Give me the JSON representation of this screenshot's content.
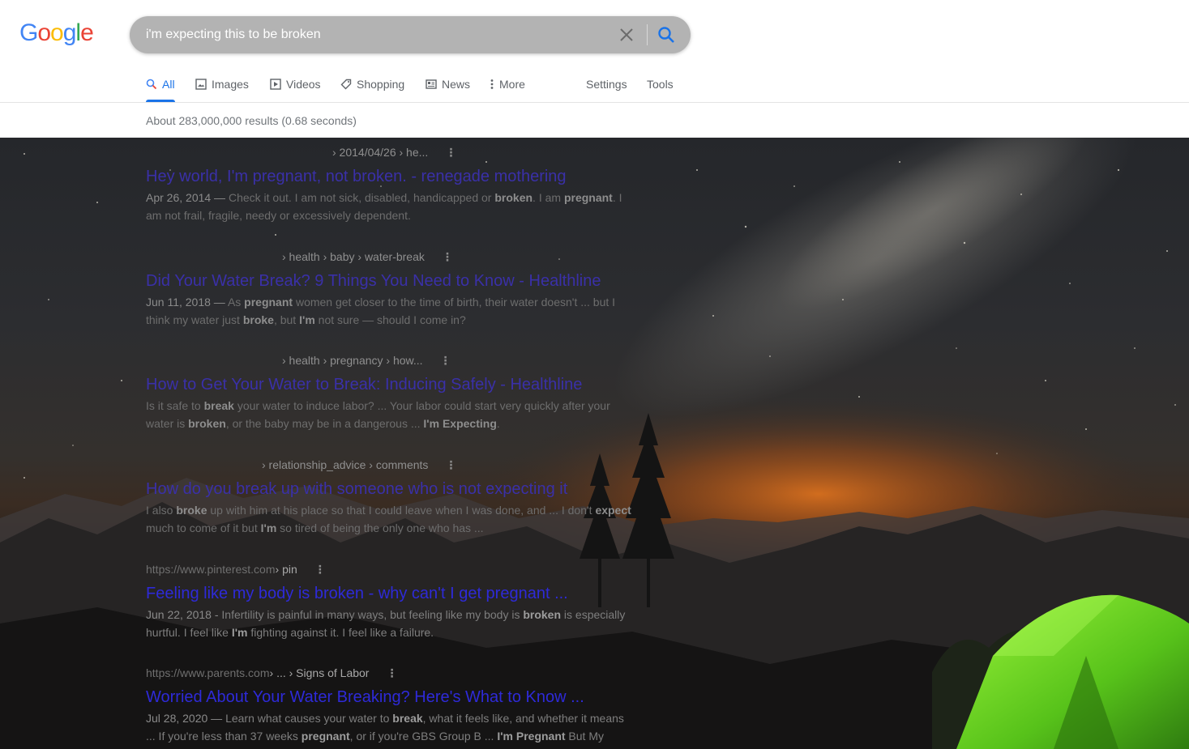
{
  "logo": {
    "letters": [
      "G",
      "o",
      "o",
      "g",
      "l",
      "e"
    ],
    "colors": [
      "#4285F4",
      "#EA4335",
      "#FBBC05",
      "#4285F4",
      "#34A853",
      "#EA4335"
    ]
  },
  "search": {
    "query": "i'm expecting this to be broken",
    "accent": "#1a73e8"
  },
  "tabs": [
    {
      "label": "All",
      "icon": "search-icon",
      "active": true
    },
    {
      "label": "Images",
      "icon": "image-icon"
    },
    {
      "label": "Videos",
      "icon": "video-icon"
    },
    {
      "label": "Shopping",
      "icon": "tag-icon"
    },
    {
      "label": "News",
      "icon": "newspaper-icon"
    },
    {
      "label": "More",
      "icon": "more-vert-icon"
    },
    {
      "label": "Settings"
    },
    {
      "label": "Tools"
    }
  ],
  "results_count": "About 283,000,000 results (0.68 seconds)",
  "results": [
    {
      "host": "",
      "path": "› 2014/04/26 › he...",
      "title": "Hey world, I'm pregnant, not broken. - renegade mothering",
      "snippet_parts": [
        {
          "t": "Apr 26, 2014 — ",
          "date": true
        },
        {
          "t": "Check it out. I am not sick, disabled, handicapped or "
        },
        {
          "t": "broken",
          "b": true
        },
        {
          "t": ". I am "
        },
        {
          "t": "pregnant",
          "b": true
        },
        {
          "t": ". I am not frail, fragile, needy or excessively dependent."
        }
      ]
    },
    {
      "host": "",
      "path": "› health › baby › water-break",
      "title": "Did Your Water Break? 9 Things You Need to Know - Healthline",
      "snippet_parts": [
        {
          "t": "Jun 11, 2018 — ",
          "date": true
        },
        {
          "t": "As "
        },
        {
          "t": "pregnant",
          "b": true
        },
        {
          "t": " women get closer to the time of birth, their water doesn't ... but I think my water just "
        },
        {
          "t": "broke",
          "b": true
        },
        {
          "t": ", but "
        },
        {
          "t": "I'm",
          "b": true
        },
        {
          "t": " not sure — should I come in?"
        }
      ]
    },
    {
      "host": "",
      "path": "› health › pregnancy › how...",
      "title": "How to Get Your Water to Break: Inducing Safely - Healthline",
      "snippet_parts": [
        {
          "t": "Is it safe to "
        },
        {
          "t": "break",
          "b": true
        },
        {
          "t": " your water to induce labor? ... Your labor could start very quickly after your water is "
        },
        {
          "t": "broken",
          "b": true
        },
        {
          "t": ", or the baby may be in a dangerous ... "
        },
        {
          "t": "I'm Expecting",
          "b": true
        },
        {
          "t": "."
        }
      ]
    },
    {
      "host": "",
      "path": "› relationship_advice › comments",
      "title": "How do you break up with someone who is not expecting it",
      "snippet_parts": [
        {
          "t": "I also "
        },
        {
          "t": "broke",
          "b": true
        },
        {
          "t": " up with him at his place so that I could leave when I was done, and ... I don't "
        },
        {
          "t": "expect",
          "b": true
        },
        {
          "t": " much to come of it but "
        },
        {
          "t": "I'm",
          "b": true
        },
        {
          "t": " so tired of being the only one who has ..."
        }
      ]
    },
    {
      "host": "https://www.pinterest.com",
      "path": " › pin",
      "title": "Feeling like my body is broken - why can't I get pregnant ...",
      "snippet_parts": [
        {
          "t": "Jun 22, 2018 - ",
          "date": true
        },
        {
          "t": "Infertility is painful in many ways, but feeling like my body is "
        },
        {
          "t": "broken",
          "b": true
        },
        {
          "t": " is especially hurtful. I feel like "
        },
        {
          "t": "I'm",
          "b": true
        },
        {
          "t": " fighting against it. I feel like a failure."
        }
      ]
    },
    {
      "host": "https://www.parents.com",
      "path": " › ... › Signs of Labor",
      "title": "Worried About Your Water Breaking? Here's What to Know ...",
      "snippet_parts": [
        {
          "t": "Jul 28, 2020 — ",
          "date": true
        },
        {
          "t": "Learn what causes your water to "
        },
        {
          "t": "break",
          "b": true
        },
        {
          "t": ", what it feels like, and whether it means ... If you're less than 37 weeks "
        },
        {
          "t": "pregnant",
          "b": true
        },
        {
          "t": ", or if you're GBS Group B ... "
        },
        {
          "t": "I'm Pregnant",
          "b": true
        },
        {
          "t": " But My"
        }
      ]
    }
  ]
}
